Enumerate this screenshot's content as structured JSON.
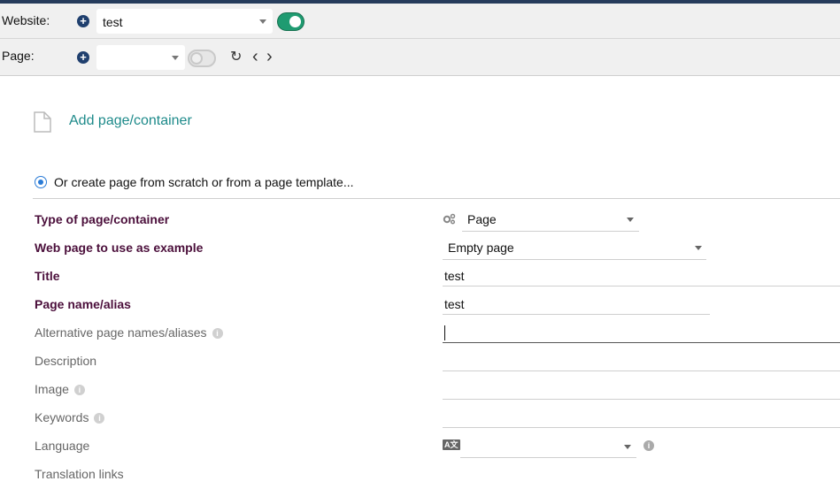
{
  "website_bar": {
    "label": "Website:",
    "selected": "test",
    "toggle": "on"
  },
  "page_bar": {
    "label": "Page:",
    "selected": "",
    "toggle": "off"
  },
  "icons": {
    "add": "plus-circle-icon",
    "refresh": "refresh-icon",
    "prev": "chevron-left-icon",
    "next": "chevron-right-icon",
    "file": "file-icon"
  },
  "glyphs": {
    "plus": "+",
    "refresh": "↻",
    "prev": "‹",
    "next": "›",
    "info": "i",
    "lang": "A文"
  },
  "add_page_link": "Add page/container",
  "create_option": "Or create page from scratch or from a page template...",
  "form": {
    "type_label": "Type of page/container",
    "type_value": "Page",
    "example_label": "Web page to use as example",
    "example_value": "Empty page",
    "title_label": "Title",
    "title_value": "test",
    "alias_label": "Page name/alias",
    "alias_value": "test",
    "alt_alias_label": "Alternative page names/aliases",
    "alt_alias_value": "",
    "description_label": "Description",
    "description_value": "",
    "image_label": "Image",
    "image_value": "",
    "keywords_label": "Keywords",
    "keywords_value": "",
    "language_label": "Language",
    "language_value": "",
    "translation_label": "Translation links"
  },
  "colors": {
    "accent_link": "#1d8a8a",
    "required_label": "#4b0f3b",
    "toggle_on": "#1f9b71",
    "top_strip": "#263c5c"
  }
}
